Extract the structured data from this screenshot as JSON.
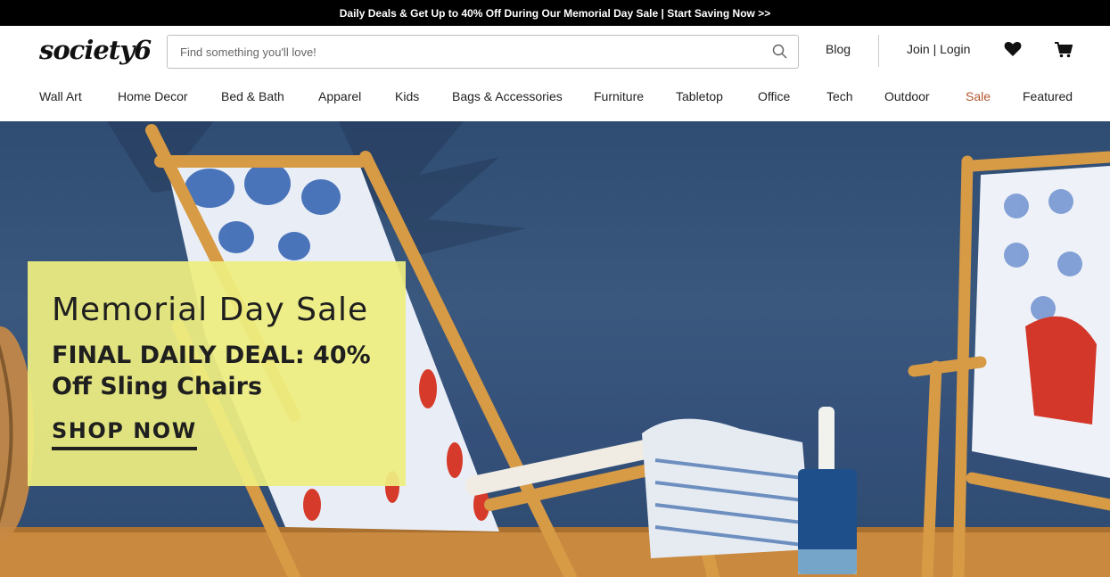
{
  "promo_bar": {
    "text": "Daily Deals & Get Up to 40% Off During Our Memorial Day Sale | Start Saving Now >>"
  },
  "header": {
    "logo": "society6",
    "search_placeholder": "Find something you'll love!",
    "blog_label": "Blog",
    "login_label": "Join | Login",
    "icons": [
      "search-icon",
      "heart-icon",
      "cart-icon"
    ]
  },
  "nav": {
    "items": [
      {
        "label": "Wall Art"
      },
      {
        "label": "Home Decor"
      },
      {
        "label": "Bed & Bath"
      },
      {
        "label": "Apparel"
      },
      {
        "label": "Kids"
      },
      {
        "label": "Bags & Accessories"
      },
      {
        "label": "Furniture"
      },
      {
        "label": "Tabletop"
      },
      {
        "label": "Office"
      },
      {
        "label": "Tech"
      },
      {
        "label": "Outdoor"
      },
      {
        "label": "Sale"
      },
      {
        "label": "Featured"
      }
    ]
  },
  "hero": {
    "title": "Memorial Day Sale",
    "subtitle": "FINAL DAILY DEAL: 40% Off Sling Chairs",
    "cta": "SHOP NOW"
  },
  "colors": {
    "promo_bar_bg": "#000000",
    "sale_link": "#b4572e",
    "promo_card_bg": "#eeee80",
    "hero_wall": "#34507a"
  }
}
